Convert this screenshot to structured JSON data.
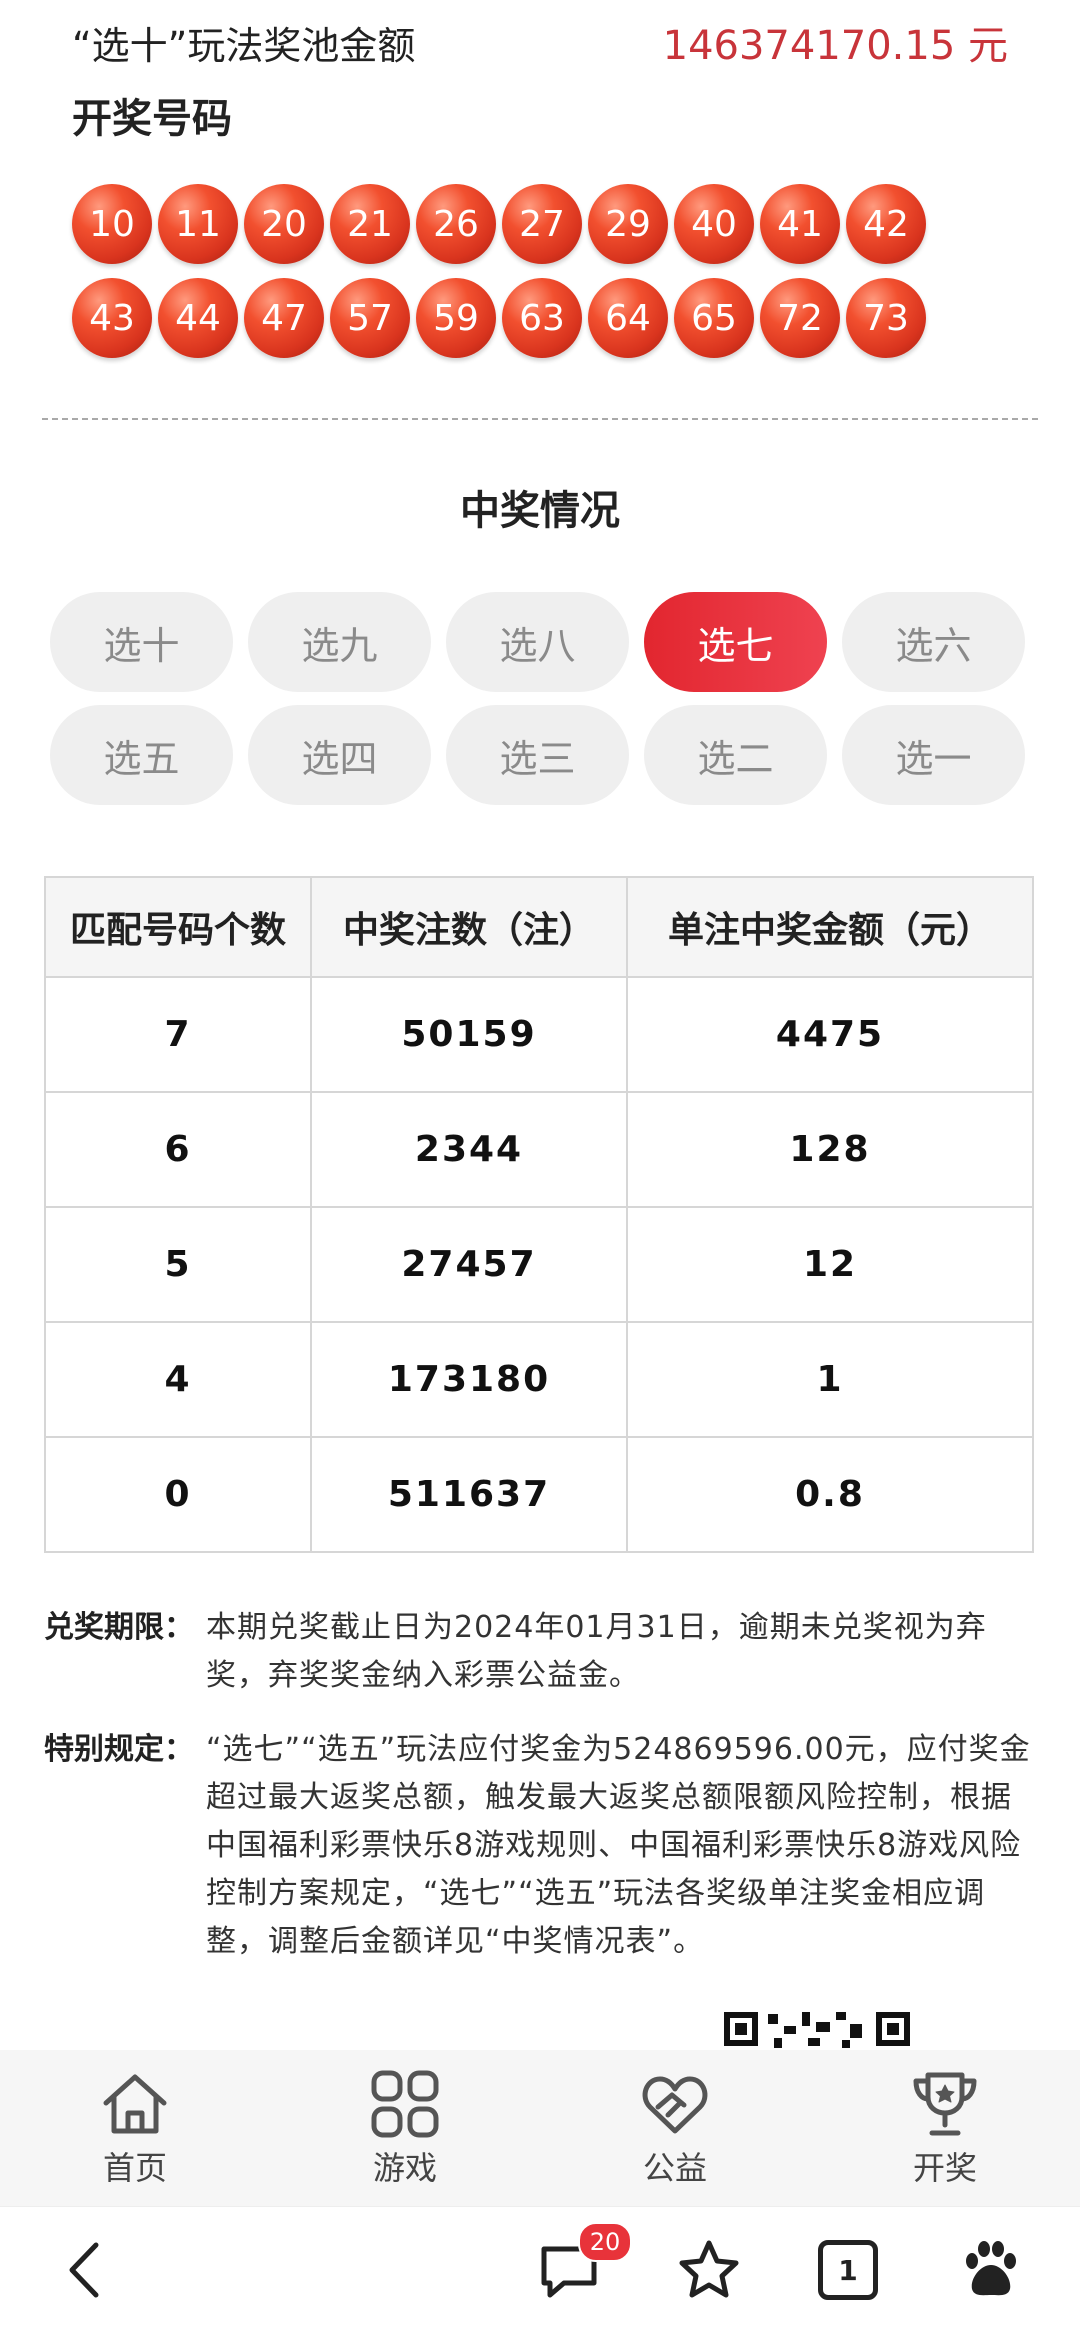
{
  "pool": {
    "label": "“选十”玩法奖池金额",
    "amount": "146374170.15 元"
  },
  "draw": {
    "title": "开奖号码",
    "numbers_row1": [
      "10",
      "11",
      "20",
      "21",
      "26",
      "27",
      "29",
      "40",
      "41",
      "42"
    ],
    "numbers_row2": [
      "43",
      "44",
      "47",
      "57",
      "59",
      "63",
      "64",
      "65",
      "72",
      "73"
    ]
  },
  "prize": {
    "title": "中奖情况",
    "tabs": [
      "选十",
      "选九",
      "选八",
      "选七",
      "选六",
      "选五",
      "选四",
      "选三",
      "选二",
      "选一"
    ],
    "active_tab": "选七",
    "table": {
      "headers": [
        "匹配号码个数",
        "中奖注数（注）",
        "单注中奖金额（元）"
      ],
      "rows": [
        [
          "7",
          "50159",
          "4475"
        ],
        [
          "6",
          "2344",
          "128"
        ],
        [
          "5",
          "27457",
          "12"
        ],
        [
          "4",
          "173180",
          "1"
        ],
        [
          "0",
          "511637",
          "0.8"
        ]
      ]
    }
  },
  "notes": {
    "deadline_label": "兑奖期限：",
    "deadline_text": "本期兑奖截止日为2024年01月31日，逾期未兑奖视为弃奖，弃奖奖金纳入彩票公益金。",
    "special_label": "特别规定：",
    "special_text": "“选七”“选五”玩法应付奖金为524869596.00元，应付奖金超过最大返奖总额，触发最大返奖总额限额风险控制，根据中国福利彩票快乐8游戏规则、中国福利彩票快乐8游戏风险控制方案规定，“选七”“选五”玩法各奖级单注奖金相应调整，调整后金额详见“中奖情况表”。"
  },
  "tabbar": {
    "items": [
      {
        "label": "首页",
        "icon": "home-icon"
      },
      {
        "label": "游戏",
        "icon": "grid-icon"
      },
      {
        "label": "公益",
        "icon": "heart-hands-icon"
      },
      {
        "label": "开奖",
        "icon": "trophy-icon"
      }
    ]
  },
  "browser": {
    "comment_count": "20",
    "tab_count": "1"
  },
  "colors": {
    "accent": "#e2262f",
    "ball": "#e0391f",
    "pool_amount": "#c8343a"
  }
}
